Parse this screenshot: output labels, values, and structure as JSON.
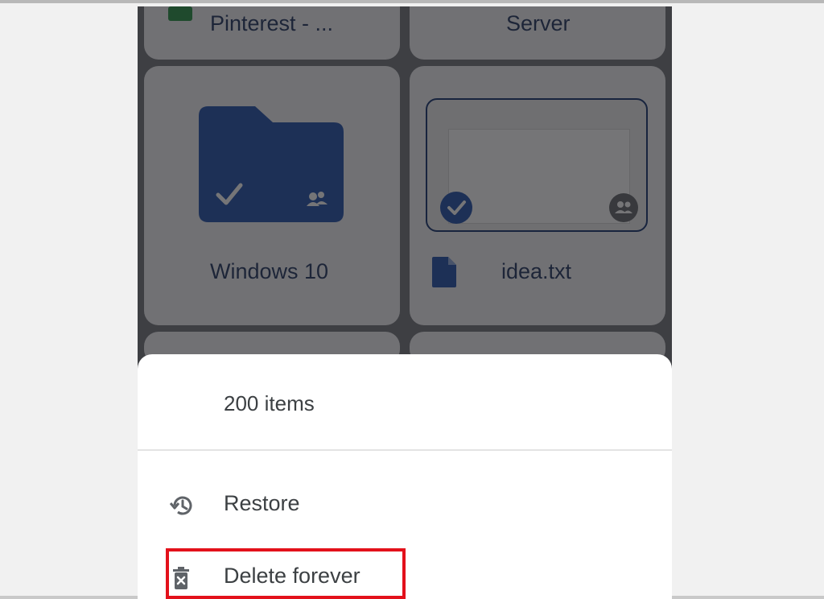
{
  "files": {
    "top_left_title": "Pinterest - ...",
    "top_right_title": "Server",
    "folder_title": "Windows 10",
    "file_title": "idea.txt"
  },
  "sheet": {
    "item_count": "200 items",
    "actions": [
      {
        "label": "Restore",
        "icon": "restore-icon"
      },
      {
        "label": "Delete forever",
        "icon": "delete-forever-icon"
      }
    ]
  },
  "colors": {
    "accent": "#1a4aa8",
    "highlight": "#e3111b",
    "scrim": "#202124"
  }
}
